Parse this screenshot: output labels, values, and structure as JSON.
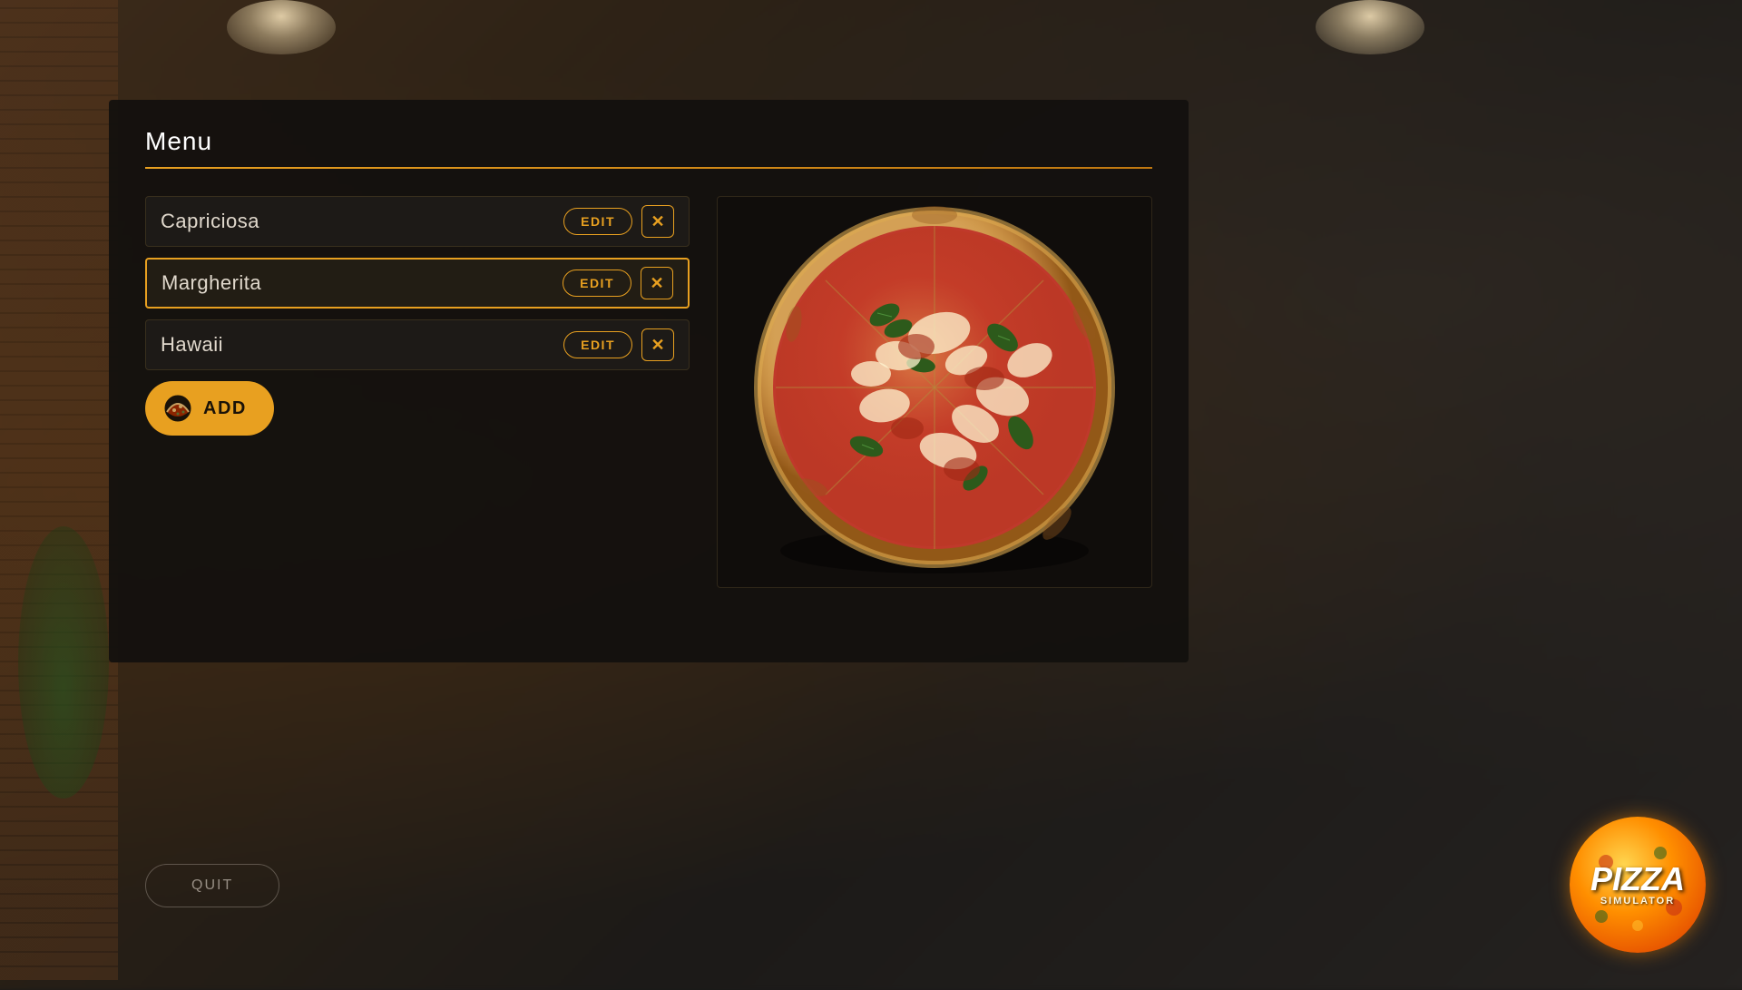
{
  "background": {
    "color": "#1a1a1a"
  },
  "panel": {
    "title": "Menu",
    "menu_items": [
      {
        "id": "capriciosa",
        "name": "Capriciosa",
        "selected": false
      },
      {
        "id": "margherita",
        "name": "Margherita",
        "selected": true
      },
      {
        "id": "hawaii",
        "name": "Hawaii",
        "selected": false
      }
    ],
    "edit_button_label": "EDIT",
    "delete_button_symbol": "✕",
    "add_button_label": "ADD"
  },
  "quit_button": {
    "label": "QUIT"
  },
  "logo": {
    "line1": "PIZZA",
    "line2": "SIMULATOR"
  }
}
